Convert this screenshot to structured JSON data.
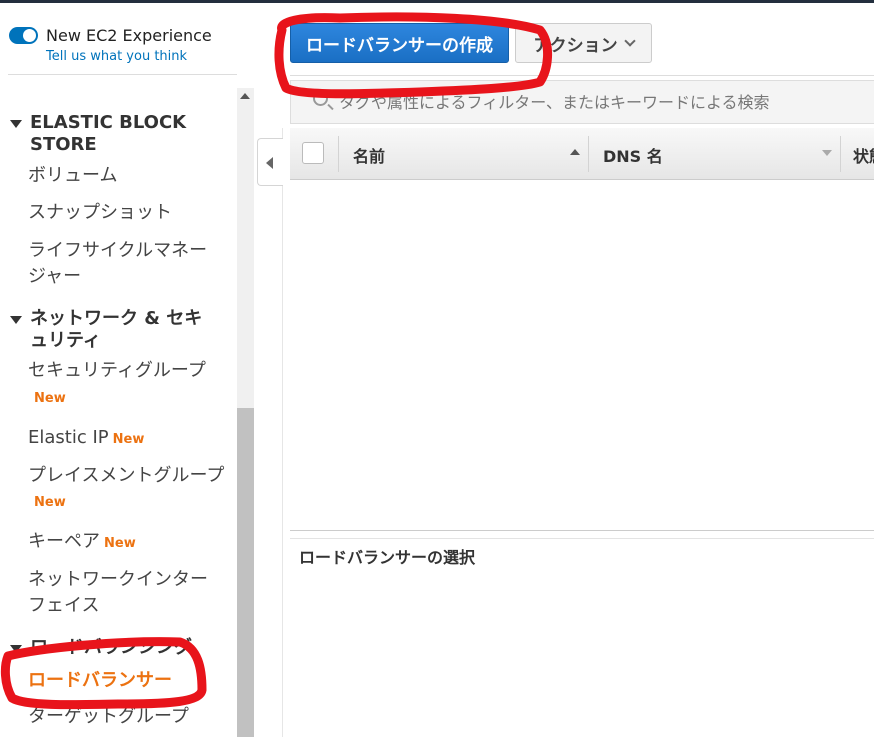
{
  "experience": {
    "toggle_label": "New EC2 Experience",
    "feedback_link": "Tell us what you think"
  },
  "sidebar": {
    "sections": [
      {
        "label": "ELASTIC BLOCK STORE"
      },
      {
        "label": "ネットワーク & セキュリティ"
      },
      {
        "label": "ロードバランシング"
      }
    ],
    "items": [
      {
        "label": "ボリューム"
      },
      {
        "label": "スナップショット"
      },
      {
        "label": "ライフサイクルマネージャー"
      },
      {
        "label": "セキュリティグループ",
        "badge": "New"
      },
      {
        "label": "Elastic IP",
        "badge": "New"
      },
      {
        "label": "プレイスメントグループ",
        "badge": "New"
      },
      {
        "label": "キーペア",
        "badge": "New"
      },
      {
        "label": "ネットワークインターフェイス"
      },
      {
        "label": "ロードバランサー",
        "active": true
      },
      {
        "label": "ターゲットグループ"
      }
    ]
  },
  "toolbar": {
    "create_label": "ロードバランサーの作成",
    "actions_label": "アクション"
  },
  "search": {
    "placeholder": "タグや属性によるフィルター、またはキーワードによる検索"
  },
  "table": {
    "columns": [
      "名前",
      "DNS 名",
      "状態"
    ]
  },
  "details": {
    "title": "ロードバランサーの選択"
  },
  "colors": {
    "accent": "#0073bb",
    "primary_button": "#1a6fc4",
    "badge_new": "#ec7211",
    "active_item": "#ec7211",
    "annotation": "#e8141b"
  }
}
